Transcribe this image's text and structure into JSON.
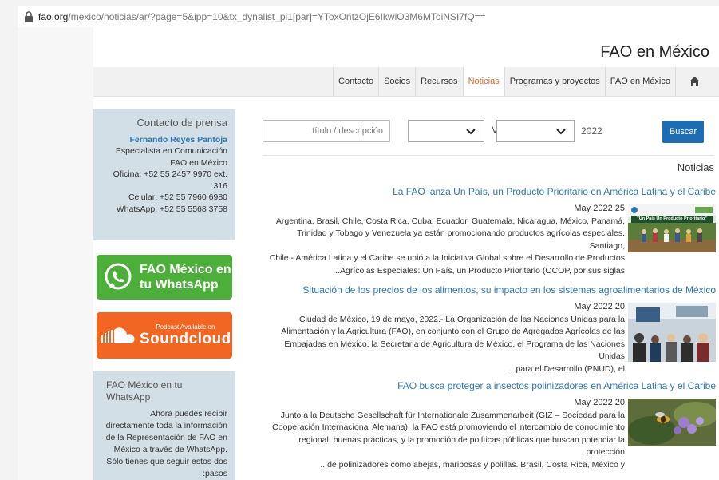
{
  "browser": {
    "url_host": "fao.org",
    "url_path": "/mexico/noticias/ar/?page=5&ipp=10&tx_dynalist_pi1[par]=YToxOntzOjE6IkwiO3M6MToiNSI7fQ=="
  },
  "site": {
    "title": "FAO en México"
  },
  "nav": {
    "items": [
      "Contacto",
      "Socios",
      "Recursos",
      "Noticias",
      "Programas y proyectos",
      "FAO en México"
    ],
    "active_index": 3
  },
  "sidebar": {
    "press": {
      "title": "Contacto de prensa",
      "name": "Fernando Reyes Pantoja",
      "role": "Especialista en Comunicación",
      "org": "FAO en México",
      "office": "Oficina: +52 55 2457 9970 ext.",
      "ext": "316",
      "cell": "Celular: +52 55 7960 6980",
      "whatsapp": "WhatsApp: +52 55 5568 3758"
    },
    "wa_button": {
      "line1": "FAO México en",
      "line2": "tu WhatsApp"
    },
    "sc_button": {
      "small": "Podcast Available on",
      "big": "Soundcloud"
    },
    "wa_box": {
      "title": "FAO México en tu WhatsApp",
      "lines": [
        "Ahora puedes recibir",
        "directamente toda la información",
        "de la Representación de FAO en",
        "México a través de WhatsApp.",
        "Sólo tienes que seguir estos dos",
        ":pasos"
      ]
    }
  },
  "search": {
    "placeholder": "título / descripción",
    "m_label": "M",
    "year": "2022",
    "button": "Buscar"
  },
  "section_title": "Noticias",
  "news": [
    {
      "title": "La FAO lanza Un País, un Producto Prioritario en América Latina y el Caribe",
      "date": "May 2022 25",
      "lines": [
        "Argentina, Brasil, Chile, Costa Rica, Cuba, Ecuador, Guatemala, Nicaragua, México, Panamá,",
        "Trinidad y Tobago y Venezuela ya están promocionando productos agrícolas especiales. Santiago,",
        "Chile - América Latina y el Caribe se unió a la Iniciativa Global sobre el Desarrollo de Productos",
        "...Agrícolas Especiales: Un País, un Producto Prioritario (OCOP, por sus siglas"
      ],
      "thumb_caption": "\"Un País Un Producto Prioritario\""
    },
    {
      "title": "Situación de los precios de los alimentos, su impacto en los sistemas agroalimentarios de México",
      "date": "May 2022 20",
      "lines": [
        "Ciudad de México, 19 de mayo, 2022.- La Organización de las Naciones Unidas para la",
        "Alimentación y la Agricultura (FAO), en conjunto con el Grupo de Agregados Agrícolas de las",
        "Embajadas en México, la Secretaria de Agricultura de México, el Programa de las Naciones Unidas",
        "...para el Desarrollo (PNUD), el"
      ]
    },
    {
      "title": "FAO busca proteger a insectos polinizadores en América Latina y el Caribe",
      "date": "May 2022 20",
      "lines": [
        "Junto a la Deutsche Gesellschaft für Internationale Zusammenarbeit (GIZ – Sociedad para la",
        "Cooperación Internacional Alemana), la FAO está promoviendo el intercambio de conocimiento",
        "regional, buenas prácticas, y la promoción de políticas públicas que buscan potenciar la protección",
        "...de polinizadores como abejas, mariposas y polillas. Brasil, Costa Rica, México y"
      ]
    }
  ]
}
